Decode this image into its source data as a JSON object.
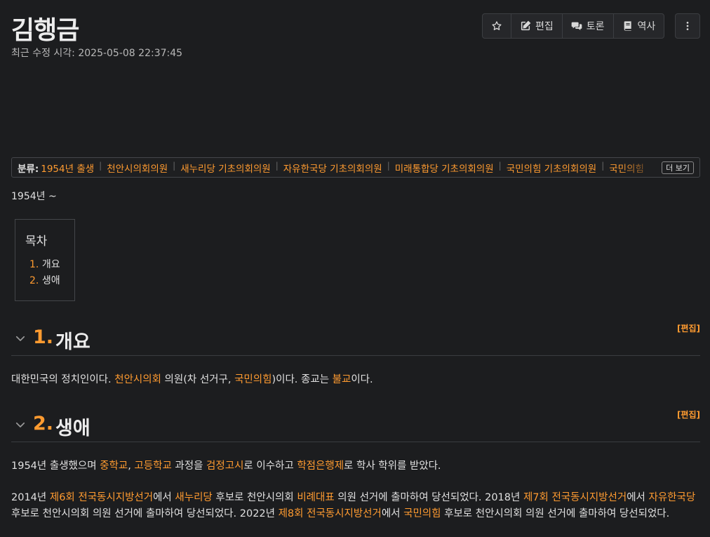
{
  "page": {
    "title": "김행금",
    "last_modified": "최근 수정 시각: 2025-05-08 22:37:45"
  },
  "toolbar": {
    "edit_label": "편집",
    "discuss_label": "토론",
    "history_label": "역사"
  },
  "categories": {
    "label": "분류:",
    "items": [
      "1954년 출생",
      "천안시의회의원",
      "새누리당 기초의회의원",
      "자유한국당 기초의회의원",
      "미래통합당 기초의회의원",
      "국민의힘 기초의회의원",
      "국민의힘"
    ],
    "more_label": "더 보기"
  },
  "lifespan": "1954년 ~",
  "toc": {
    "title": "목차",
    "items": [
      {
        "num": "1.",
        "label": "개요"
      },
      {
        "num": "2.",
        "label": "생애"
      }
    ]
  },
  "sections": [
    {
      "num": "1.",
      "title": "개요",
      "edit_label": "편집"
    },
    {
      "num": "2.",
      "title": "생애",
      "edit_label": "편집"
    }
  ],
  "overview": {
    "t1": "대한민국의 정치인이다. ",
    "l1": "천안시의회",
    "t2": " 의원(차 선거구, ",
    "l2": "국민의힘",
    "t3": ")이다. 종교는 ",
    "l3": "불교",
    "t4": "이다."
  },
  "life_p1": {
    "t1": "1954년 출생했으며 ",
    "l1": "중학교",
    "t2": ", ",
    "l2": "고등학교",
    "t3": " 과정을 ",
    "l3": "검정고시",
    "t4": "로 이수하고 ",
    "l4": "학점은행제",
    "t5": "로 학사 학위를 받았다."
  },
  "life_p2": {
    "t1": "2014년 ",
    "l1": "제6회 전국동시지방선거",
    "t2": "에서 ",
    "l2": "새누리당",
    "t3": " 후보로 천안시의회 ",
    "l3": "비례대표",
    "t4": " 의원 선거에 출마하여 당선되었다. 2018년 ",
    "l4": "제7회 전국동시지방선거",
    "t5": "에서 ",
    "l5": "자유한국당",
    "t6": " 후보로 천안시의회 의원 선거에 출마하여 당선되었다. 2022년 ",
    "l6": "제8회 전국동시지방선거",
    "t7": "에서 ",
    "l7": "국민의힘",
    "t8": " 후보로 천안시의회 의원 선거에 출마하여 당선되었다."
  },
  "colors": {
    "background": "#1c1d1f",
    "link": "#ff9b30",
    "text": "#e0e0e0"
  }
}
